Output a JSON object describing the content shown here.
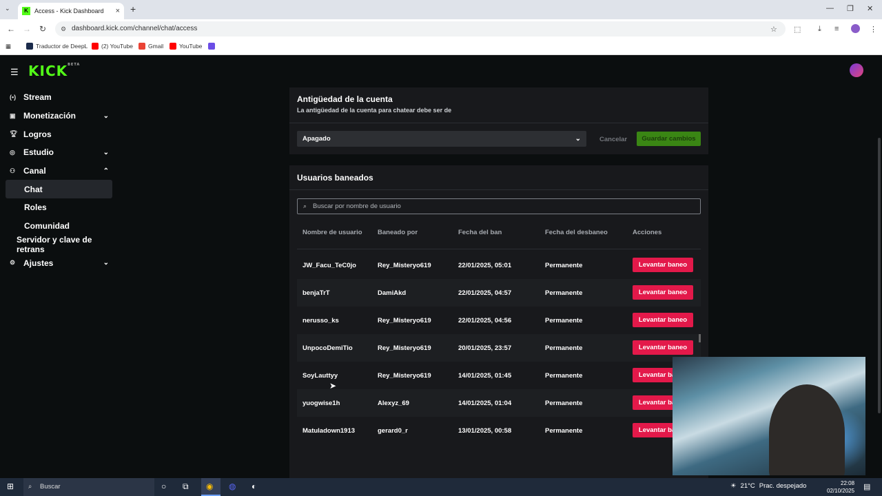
{
  "browser": {
    "tab_title": "Access - Kick Dashboard",
    "url": "dashboard.kick.com/channel/chat/access",
    "bookmarks": [
      {
        "label": "Traductor de DeepL",
        "color": "#1b2b4b"
      },
      {
        "label": "(2) YouTube",
        "color": "#ff0000"
      },
      {
        "label": "Gmail",
        "color": "#ea4335"
      },
      {
        "label": "YouTube",
        "color": "#ff0000"
      }
    ]
  },
  "header": {
    "logo": "KICK",
    "logo_badge": "BETA"
  },
  "sidebar": {
    "items": [
      {
        "label": "Stream",
        "icon": "broadcast-icon"
      },
      {
        "label": "Monetización",
        "icon": "chart-icon"
      },
      {
        "label": "Logros",
        "icon": "trophy-icon"
      },
      {
        "label": "Estudio",
        "icon": "studio-icon"
      },
      {
        "label": "Canal",
        "icon": "channel-icon"
      },
      {
        "label": "Chat"
      },
      {
        "label": "Roles"
      },
      {
        "label": "Comunidad"
      },
      {
        "label": "Servidor y clave de retrans"
      },
      {
        "label": "Ajustes",
        "icon": "gear-icon"
      }
    ]
  },
  "account_age": {
    "title": "Antigüedad de la cuenta",
    "description": "La antigüedad de la cuenta para chatear debe ser de",
    "select_value": "Apagado",
    "cancel_label": "Cancelar",
    "save_label": "Guardar cambios"
  },
  "banned": {
    "title": "Usuarios baneados",
    "search_placeholder": "Buscar por nombre de usuario",
    "columns": [
      "Nombre de usuario",
      "Baneado por",
      "Fecha del ban",
      "Fecha del desbaneo",
      "Acciones"
    ],
    "action_label": "Levantar baneo",
    "rows": [
      {
        "user": "JW_Facu_TeC0jo",
        "by": "Rey_Misteryo619",
        "date": "22/01/2025, 05:01",
        "until": "Permanente"
      },
      {
        "user": "benjaTrT",
        "by": "DamiAkd",
        "date": "22/01/2025, 04:57",
        "until": "Permanente"
      },
      {
        "user": "nerusso_ks",
        "by": "Rey_Misteryo619",
        "date": "22/01/2025, 04:56",
        "until": "Permanente"
      },
      {
        "user": "UnpocoDemiTio",
        "by": "Rey_Misteryo619",
        "date": "20/01/2025, 23:57",
        "until": "Permanente"
      },
      {
        "user": "SoyLauttyy",
        "by": "Rey_Misteryo619",
        "date": "14/01/2025, 01:45",
        "until": "Permanente"
      },
      {
        "user": "yuogwise1h",
        "by": "Alexyz_69",
        "date": "14/01/2025, 01:04",
        "until": "Permanente"
      },
      {
        "user": "Matuladown1913",
        "by": "gerard0_r",
        "date": "13/01/2025, 00:58",
        "until": "Permanente"
      }
    ]
  },
  "taskbar": {
    "search": "Buscar",
    "weather": "21°C",
    "weather_desc": "Prac. despejado",
    "time": "22:08",
    "date": "02/10/2025"
  }
}
